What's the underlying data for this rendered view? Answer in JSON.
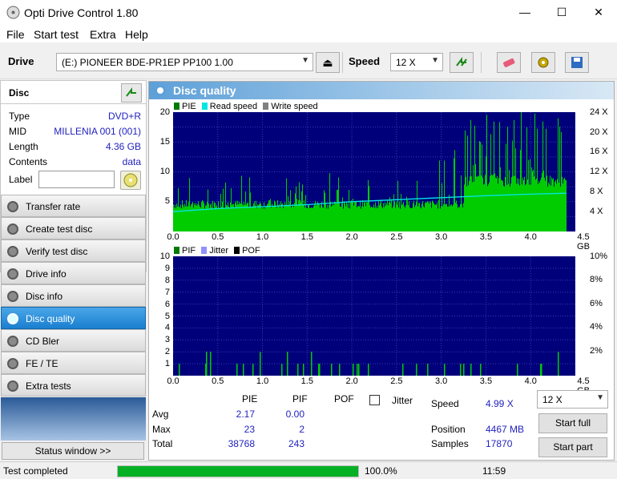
{
  "window": {
    "title": "Opti Drive Control 1.80",
    "min": "—",
    "max": "☐",
    "close": "✕"
  },
  "menu": [
    "File",
    "Start test",
    "Extra",
    "Help"
  ],
  "toolbar": {
    "drive_label": "Drive",
    "drive_value": "(E:)   PIONEER BDE-PR1EP  PP100 1.00",
    "speed_label": "Speed",
    "speed_value": "12 X"
  },
  "disc": {
    "header": "Disc",
    "fields": [
      {
        "key": "Type",
        "value": "DVD+R"
      },
      {
        "key": "MID",
        "value": "MILLENIA 001 (001)"
      },
      {
        "key": "Length",
        "value": "4.36 GB"
      },
      {
        "key": "Contents",
        "value": "data"
      },
      {
        "key": "Label",
        "value": ""
      }
    ]
  },
  "nav": [
    "Transfer rate",
    "Create test disc",
    "Verify test disc",
    "Drive info",
    "Disc info",
    "Disc quality",
    "CD Bler",
    "FE / TE",
    "Extra tests"
  ],
  "nav_active": "Disc quality",
  "status_window": "Status window >>",
  "panel": {
    "title": "Disc quality"
  },
  "legend_top": [
    "PIE",
    "Read speed",
    "Write speed"
  ],
  "legend_bottom": [
    "PIF",
    "Jitter",
    "POF"
  ],
  "colors": {
    "pie": "#00cc00",
    "read": "#00e5e5",
    "write": "#808080",
    "pif": "#00cc00",
    "jitter": "#9090ff",
    "pof": "#000000",
    "plot_bg": "#00007a",
    "accent": "#1f1fbf"
  },
  "chart_data": [
    {
      "type": "area",
      "series": [
        {
          "name": "PIE",
          "note": "average around 2, max 23"
        },
        {
          "name": "Read speed",
          "values_x": [
            0.0,
            0.5,
            1.0,
            1.5,
            2.0,
            2.5,
            3.0,
            3.5,
            4.0,
            4.4
          ],
          "values": [
            4.0,
            4.6,
            5.0,
            5.4,
            6.0,
            6.4,
            6.8,
            7.2,
            7.5,
            7.7
          ]
        }
      ],
      "xlim": [
        0,
        4.5
      ],
      "ylim": [
        0,
        20
      ],
      "y2lim": [
        0,
        24
      ],
      "x_ticks": [
        "0.0",
        "0.5",
        "1.0",
        "1.5",
        "2.0",
        "2.5",
        "3.0",
        "3.5",
        "4.0",
        "4.5 GB"
      ],
      "y_ticks": [
        "20",
        "15",
        "10",
        "5"
      ],
      "y2_ticks": [
        "24 X",
        "20 X",
        "16 X",
        "12 X",
        "8 X",
        "4 X"
      ]
    },
    {
      "type": "bar",
      "series": [
        {
          "name": "PIF",
          "note": "sparse spikes, max 2"
        }
      ],
      "xlim": [
        0,
        4.5
      ],
      "ylim": [
        0,
        10
      ],
      "y2lim": [
        0,
        10
      ],
      "x_ticks": [
        "0.0",
        "0.5",
        "1.0",
        "1.5",
        "2.0",
        "2.5",
        "3.0",
        "3.5",
        "4.0",
        "4.5 GB"
      ],
      "y_ticks": [
        "10",
        "9",
        "8",
        "7",
        "6",
        "5",
        "4",
        "3",
        "2",
        "1"
      ],
      "y2_ticks": [
        "10%",
        "8%",
        "6%",
        "4%",
        "2%"
      ]
    }
  ],
  "stats": {
    "headers": [
      "PIE",
      "PIF",
      "POF",
      "Jitter"
    ],
    "rows": [
      {
        "label": "Avg",
        "pie": "2.17",
        "pif": "0.00"
      },
      {
        "label": "Max",
        "pie": "23",
        "pif": "2"
      },
      {
        "label": "Total",
        "pie": "38768",
        "pif": "243"
      }
    ],
    "speed_label": "Speed",
    "speed_value": "4.99 X",
    "position_label": "Position",
    "position_value": "4467 MB",
    "samples_label": "Samples",
    "samples_value": "17870",
    "speed_select": "12 X",
    "start_full": "Start full",
    "start_part": "Start part"
  },
  "status": {
    "text": "Test completed",
    "progress": 100,
    "progress_text": "100.0%",
    "time": "11:59"
  }
}
